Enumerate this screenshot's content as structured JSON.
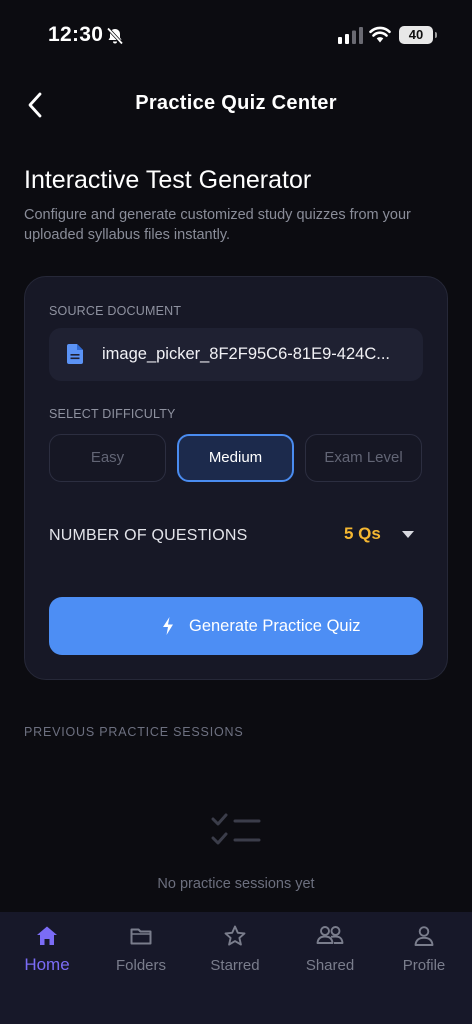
{
  "status_bar": {
    "time": "12:30",
    "battery": "40"
  },
  "header": {
    "title": "Practice Quiz Center"
  },
  "intro": {
    "heading": "Interactive Test Generator",
    "description": "Configure and generate customized study quizzes from your uploaded syllabus files instantly."
  },
  "card": {
    "source_label": "SOURCE DOCUMENT",
    "document_name": "image_picker_8F2F95C6-81E9-424C...",
    "difficulty_label": "SELECT DIFFICULTY",
    "difficulties": [
      {
        "label": "Easy",
        "active": false
      },
      {
        "label": "Medium",
        "active": true
      },
      {
        "label": "Exam Level",
        "active": false
      }
    ],
    "questions_label": "NUMBER OF QUESTIONS",
    "questions_value": "5 Qs",
    "generate_label": "Generate Practice Quiz"
  },
  "sessions": {
    "heading": "PREVIOUS PRACTICE SESSIONS",
    "empty_text": "No practice sessions yet"
  },
  "tabs": [
    {
      "label": "Home",
      "icon": "home-icon",
      "active": true
    },
    {
      "label": "Folders",
      "icon": "folder-icon",
      "active": false
    },
    {
      "label": "Starred",
      "icon": "star-icon",
      "active": false
    },
    {
      "label": "Shared",
      "icon": "users-icon",
      "active": false
    },
    {
      "label": "Profile",
      "icon": "person-icon",
      "active": false
    }
  ],
  "colors": {
    "background": "#0c0c11",
    "card": "#171826",
    "accent_blue": "#4d8ef4",
    "accent_yellow": "#f5b731",
    "active_tab": "#7b6cf6"
  }
}
